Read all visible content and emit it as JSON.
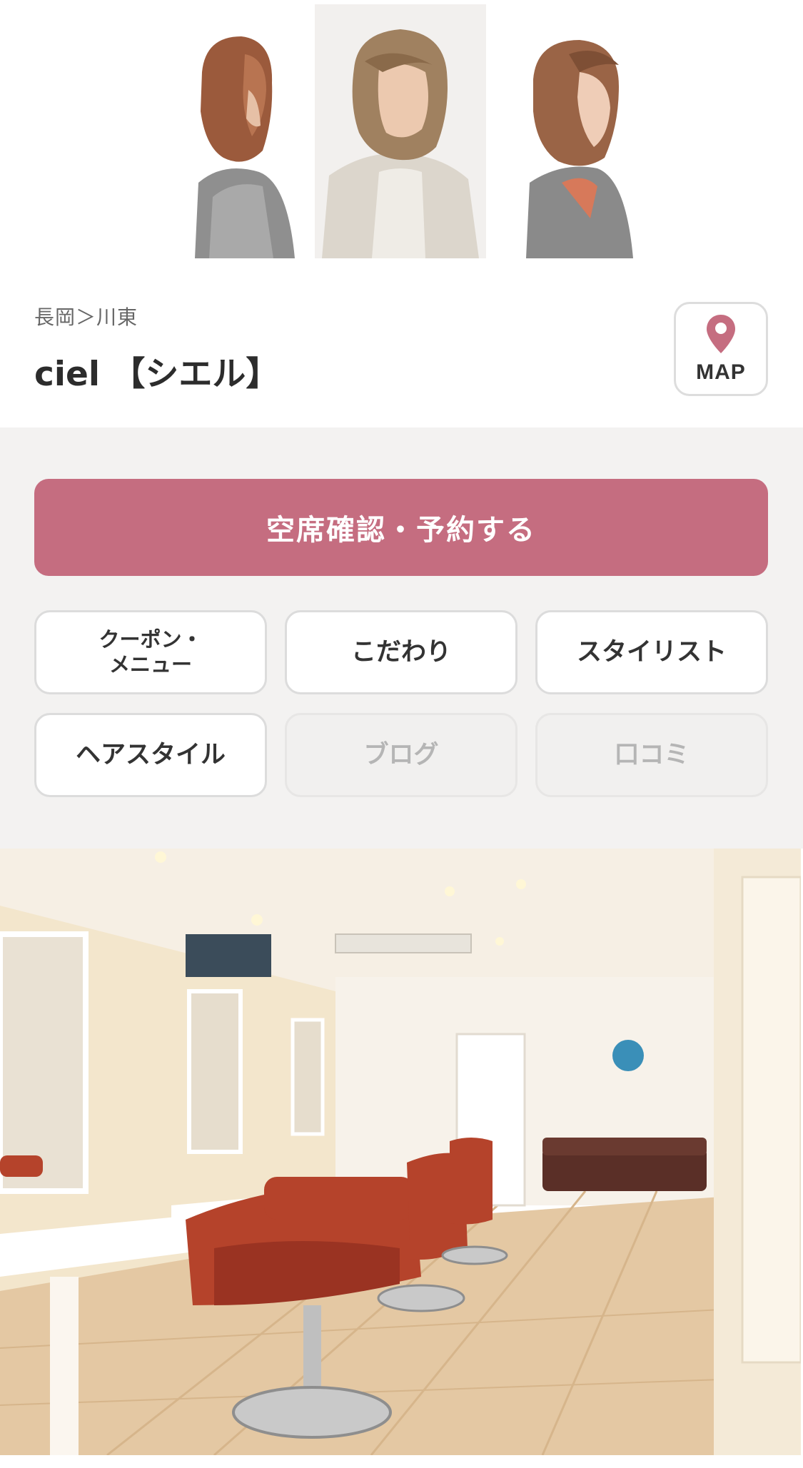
{
  "hero": {
    "photos": [
      "hairstyle-side-left",
      "hairstyle-front",
      "hairstyle-side-right"
    ]
  },
  "shop": {
    "breadcrumb": "長岡＞川東",
    "name": "ciel 【シエル】",
    "map_label": "MAP"
  },
  "actions": {
    "reserve_label": "空席確認・予約する",
    "nav": [
      {
        "label_line1": "クーポン・",
        "label_line2": "メニュー",
        "enabled": true
      },
      {
        "label": "こだわり",
        "enabled": true
      },
      {
        "label": "スタイリスト",
        "enabled": true
      },
      {
        "label": "ヘアスタイル",
        "enabled": true
      },
      {
        "label": "ブログ",
        "enabled": false
      },
      {
        "label": "口コミ",
        "enabled": false
      }
    ]
  },
  "colors": {
    "accent": "#c56d80",
    "background_gray": "#f3f2f1",
    "disabled_text": "#b5b5b5"
  }
}
